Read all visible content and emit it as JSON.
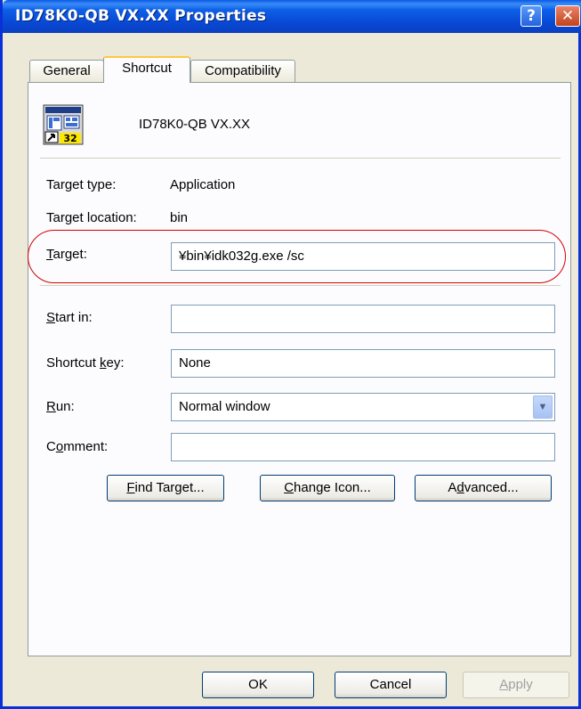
{
  "window": {
    "title": "ID78K0-QB  VX.XX Properties",
    "help_glyph": "?",
    "close_glyph": "✕"
  },
  "tabs": [
    {
      "label": "General"
    },
    {
      "label": "Shortcut"
    },
    {
      "label": "Compatibility"
    }
  ],
  "shortcut": {
    "name": "ID78K0-QB VX.XX",
    "icon_badge": "32",
    "target_type_label": "Target type:",
    "target_type_value": "Application",
    "target_location_label": "Target location:",
    "target_location_value": "bin",
    "target_label_mn": "T",
    "target_label_rest": "arget:",
    "target_value": "¥bin¥idk032g.exe /sc",
    "start_in_label_mn": "S",
    "start_in_label_rest": "tart in:",
    "start_in_value": "",
    "shortcut_key_label_pre": "Shortcut ",
    "shortcut_key_label_mn": "k",
    "shortcut_key_label_rest": "ey:",
    "shortcut_key_value": "None",
    "run_label_mn": "R",
    "run_label_rest": "un:",
    "run_value": "Normal window",
    "comment_label_pre": "C",
    "comment_label_mn": "o",
    "comment_label_rest": "mment:",
    "comment_value": "",
    "find_target_mn": "F",
    "find_target_rest": "ind Target...",
    "change_icon_mn": "C",
    "change_icon_rest": "hange Icon...",
    "advanced_pre": "A",
    "advanced_mn": "d",
    "advanced_rest": "vanced..."
  },
  "footer": {
    "ok": "OK",
    "cancel": "Cancel",
    "apply_mn": "A",
    "apply_rest": "pply"
  },
  "colors": {
    "titlebar": "#0a58e6",
    "highlight": "#d40000",
    "face": "#ece9d8"
  }
}
